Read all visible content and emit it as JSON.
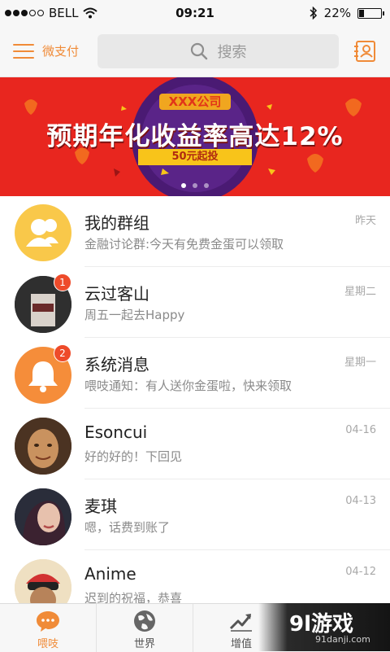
{
  "status_bar": {
    "carrier": "BELL",
    "time": "09:21",
    "battery": "22%",
    "battery_level": 0.22
  },
  "header": {
    "menu_label": "微支付",
    "search_placeholder": "搜索",
    "menu_icon": "hamburger-icon",
    "contact_icon": "contact-card-icon"
  },
  "banner": {
    "tag": "XXX公司",
    "title": "预期年化收益率高达12%",
    "subtitle": "50元起投",
    "pages": 3,
    "active_page": 0
  },
  "conversations": [
    {
      "name": "我的群组",
      "message": "金融讨论群:今天有免费金蛋可以领取",
      "time": "昨天",
      "badge": ""
    },
    {
      "name": "云过客山",
      "message": "周五一起去Happy",
      "time": "星期二",
      "badge": "1"
    },
    {
      "name": "系统消息",
      "message": "喂吱通知：有人送你金蛋啦，快来领取",
      "time": "星期一",
      "badge": "2"
    },
    {
      "name": "Esoncui",
      "message": "好的好的！下回见",
      "time": "04-16",
      "badge": ""
    },
    {
      "name": "麦琪",
      "message": "嗯，话费到账了",
      "time": "04-13",
      "badge": ""
    },
    {
      "name": "Anime",
      "message": "迟到的祝福，恭喜",
      "time": "04-12",
      "badge": ""
    }
  ],
  "tabs": [
    {
      "label": "喂吱",
      "icon": "chat-bubble-icon",
      "active": true
    },
    {
      "label": "世界",
      "icon": "globe-icon",
      "active": false
    },
    {
      "label": "增值",
      "icon": "growth-chart-icon",
      "active": false
    }
  ],
  "watermark": {
    "main": "9l游戏",
    "sub": "91danji.com"
  },
  "colors": {
    "accent": "#f08b38",
    "banner_red": "#e8261f",
    "badge_red": "#ee4b2a"
  }
}
